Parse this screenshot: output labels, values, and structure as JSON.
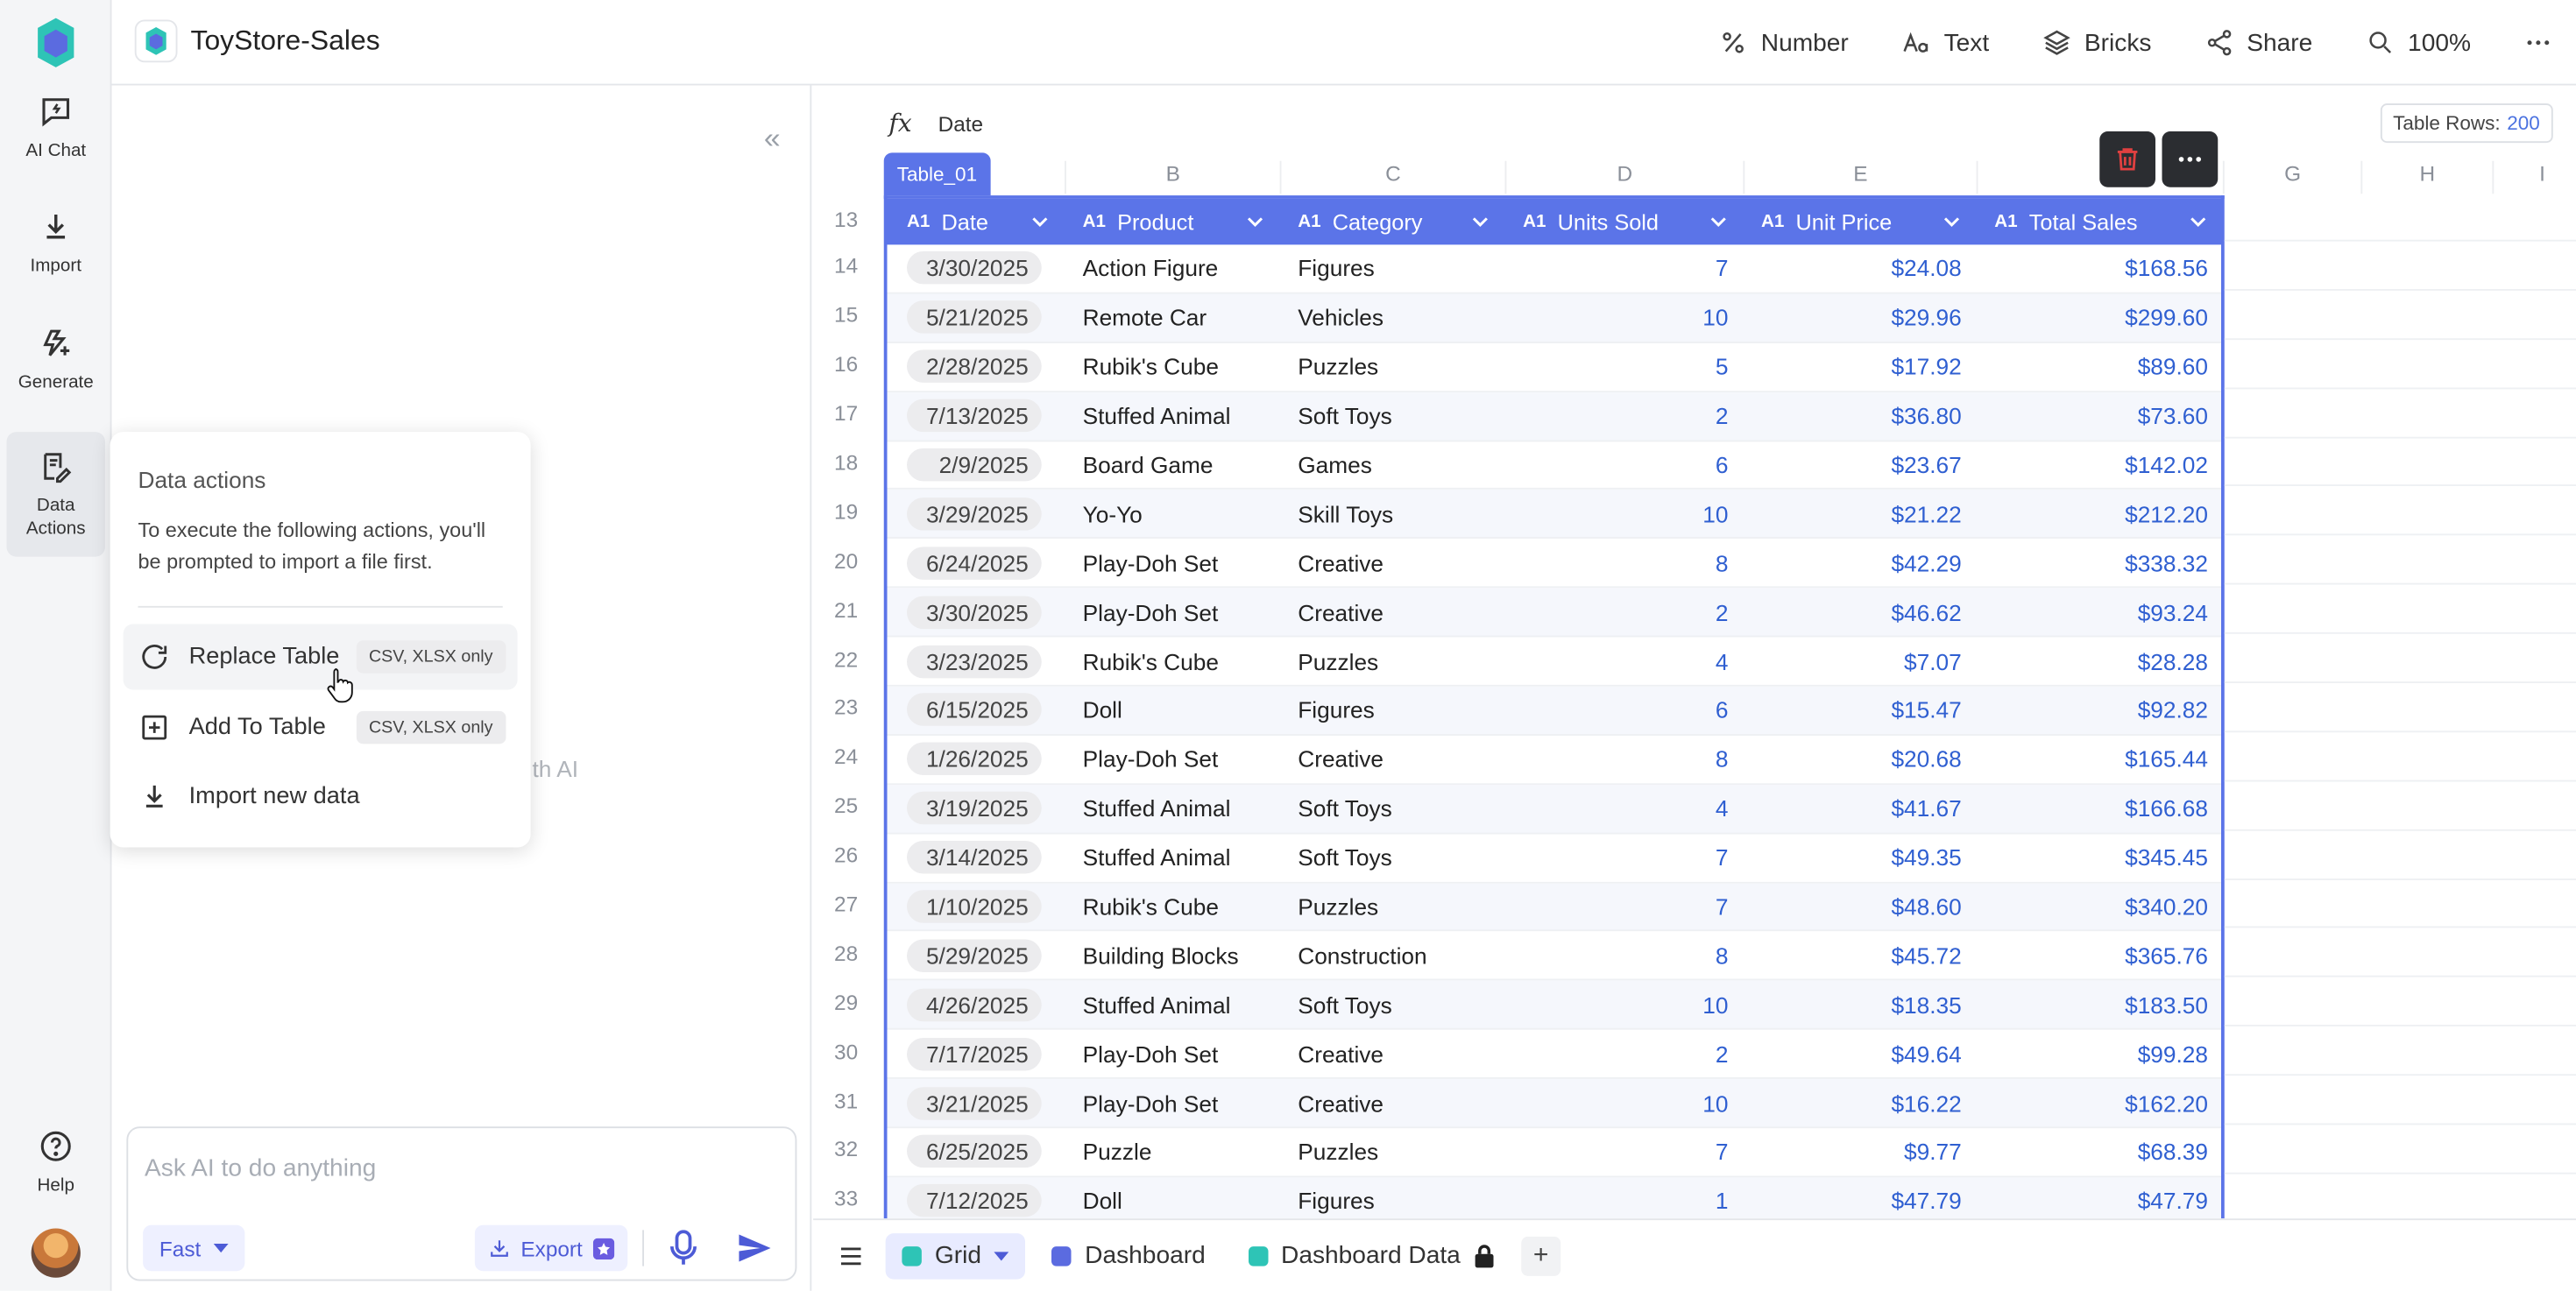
{
  "app": {
    "title": "ToyStore-Sales"
  },
  "rail": {
    "items": [
      {
        "label": "AI Chat",
        "icon": "ai-chat-icon"
      },
      {
        "label": "Import",
        "icon": "import-icon"
      },
      {
        "label": "Generate",
        "icon": "generate-icon"
      },
      {
        "label": "Data\nActions",
        "icon": "data-actions-icon"
      }
    ],
    "help_label": "Help"
  },
  "toolbar": {
    "number": "Number",
    "text": "Text",
    "bricks": "Bricks",
    "share": "Share",
    "zoom": "100%"
  },
  "panel": {
    "ghost_text": "th AI",
    "chat_placeholder": "Ask AI to do anything",
    "mode": "Fast",
    "export": "Export"
  },
  "popup": {
    "title": "Data actions",
    "description": "To execute the following actions, you'll be prompted to import a file first.",
    "actions": [
      {
        "label": "Replace Table",
        "badge": "CSV, XLSX only",
        "icon": "refresh-icon"
      },
      {
        "label": "Add To Table",
        "badge": "CSV, XLSX only",
        "icon": "add-square-icon"
      },
      {
        "label": "Import new data",
        "badge": "",
        "icon": "download-icon"
      }
    ]
  },
  "grid": {
    "formula_value": "Date",
    "rows_label": "Table Rows:",
    "rows_count": "200",
    "table_name": "Table_01",
    "col_letters": [
      "B",
      "C",
      "D",
      "E",
      "",
      "G",
      "H",
      "I"
    ],
    "headers": [
      "Date",
      "Product",
      "Category",
      "Units Sold",
      "Unit Price",
      "Total Sales"
    ],
    "header_row_num": "13",
    "rows": [
      {
        "n": "14",
        "date": "3/30/2025",
        "product": "Action Figure",
        "category": "Figures",
        "units": "7",
        "price": "$24.08",
        "total": "$168.56"
      },
      {
        "n": "15",
        "date": "5/21/2025",
        "product": "Remote Car",
        "category": "Vehicles",
        "units": "10",
        "price": "$29.96",
        "total": "$299.60"
      },
      {
        "n": "16",
        "date": "2/28/2025",
        "product": "Rubik's Cube",
        "category": "Puzzles",
        "units": "5",
        "price": "$17.92",
        "total": "$89.60"
      },
      {
        "n": "17",
        "date": "7/13/2025",
        "product": "Stuffed Animal",
        "category": "Soft Toys",
        "units": "2",
        "price": "$36.80",
        "total": "$73.60"
      },
      {
        "n": "18",
        "date": "2/9/2025",
        "product": "Board Game",
        "category": "Games",
        "units": "6",
        "price": "$23.67",
        "total": "$142.02"
      },
      {
        "n": "19",
        "date": "3/29/2025",
        "product": "Yo-Yo",
        "category": "Skill Toys",
        "units": "10",
        "price": "$21.22",
        "total": "$212.20"
      },
      {
        "n": "20",
        "date": "6/24/2025",
        "product": "Play-Doh Set",
        "category": "Creative",
        "units": "8",
        "price": "$42.29",
        "total": "$338.32"
      },
      {
        "n": "21",
        "date": "3/30/2025",
        "product": "Play-Doh Set",
        "category": "Creative",
        "units": "2",
        "price": "$46.62",
        "total": "$93.24"
      },
      {
        "n": "22",
        "date": "3/23/2025",
        "product": "Rubik's Cube",
        "category": "Puzzles",
        "units": "4",
        "price": "$7.07",
        "total": "$28.28"
      },
      {
        "n": "23",
        "date": "6/15/2025",
        "product": "Doll",
        "category": "Figures",
        "units": "6",
        "price": "$15.47",
        "total": "$92.82"
      },
      {
        "n": "24",
        "date": "1/26/2025",
        "product": "Play-Doh Set",
        "category": "Creative",
        "units": "8",
        "price": "$20.68",
        "total": "$165.44"
      },
      {
        "n": "25",
        "date": "3/19/2025",
        "product": "Stuffed Animal",
        "category": "Soft Toys",
        "units": "4",
        "price": "$41.67",
        "total": "$166.68"
      },
      {
        "n": "26",
        "date": "3/14/2025",
        "product": "Stuffed Animal",
        "category": "Soft Toys",
        "units": "7",
        "price": "$49.35",
        "total": "$345.45"
      },
      {
        "n": "27",
        "date": "1/10/2025",
        "product": "Rubik's Cube",
        "category": "Puzzles",
        "units": "7",
        "price": "$48.60",
        "total": "$340.20"
      },
      {
        "n": "28",
        "date": "5/29/2025",
        "product": "Building Blocks",
        "category": "Construction",
        "units": "8",
        "price": "$45.72",
        "total": "$365.76"
      },
      {
        "n": "29",
        "date": "4/26/2025",
        "product": "Stuffed Animal",
        "category": "Soft Toys",
        "units": "10",
        "price": "$18.35",
        "total": "$183.50"
      },
      {
        "n": "30",
        "date": "7/17/2025",
        "product": "Play-Doh Set",
        "category": "Creative",
        "units": "2",
        "price": "$49.64",
        "total": "$99.28"
      },
      {
        "n": "31",
        "date": "3/21/2025",
        "product": "Play-Doh Set",
        "category": "Creative",
        "units": "10",
        "price": "$16.22",
        "total": "$162.20"
      },
      {
        "n": "32",
        "date": "6/25/2025",
        "product": "Puzzle",
        "category": "Puzzles",
        "units": "7",
        "price": "$9.77",
        "total": "$68.39"
      },
      {
        "n": "33",
        "date": "7/12/2025",
        "product": "Doll",
        "category": "Figures",
        "units": "1",
        "price": "$47.79",
        "total": "$47.79"
      }
    ]
  },
  "tabs": [
    {
      "label": "Grid",
      "color": "#2ec4b6",
      "active": true
    },
    {
      "label": "Dashboard",
      "color": "#5b6be0",
      "active": false
    },
    {
      "label": "Dashboard Data",
      "color": "#2ec4b6",
      "active": false
    }
  ],
  "colors": {
    "accent": "#5b74e8",
    "number": "#2f5fd1",
    "delete": "#e04040"
  }
}
